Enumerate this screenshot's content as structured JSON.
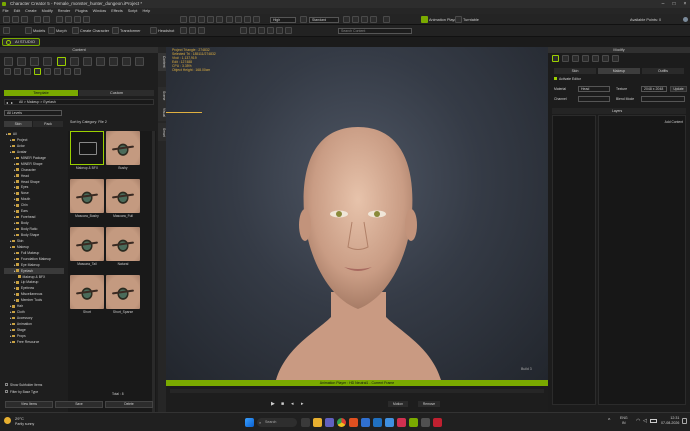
{
  "window": {
    "title": "Character Creator 5 - Female_monster_hunter_dungeon.iProject *"
  },
  "menu": [
    "File",
    "Edit",
    "Create",
    "Modify",
    "Render",
    "Plugins",
    "Window",
    "Effects",
    "Script",
    "Help"
  ],
  "toolbar": {
    "animation_player_label": "Animation Player",
    "turntable_label": "Turntable",
    "view_mode": "High",
    "camera": "Standard",
    "ai_studio_label": "AI STUDIO",
    "create_character_label": "Create Character",
    "transformer_label": "Transformer",
    "headshot_label": "Headshot",
    "search_placeholder": "Search Content",
    "models_label": "Models",
    "morph_label": "Morph",
    "avatar_status": "Available Points: 0"
  },
  "content_panel": {
    "title": "Content",
    "tabs": [
      "Template",
      "Custom"
    ],
    "path": "All > Makeup > Eyelash",
    "view_label": "All Levels",
    "side_tabs": [
      "Skin",
      "Pack"
    ],
    "sort_label": "Sort by Category: File 2",
    "tiles": [
      {
        "label": "Makeup & BFX"
      },
      {
        "label": "Bushy"
      },
      {
        "label": "Mascara_Bushy"
      },
      {
        "label": "Mascara_Full"
      },
      {
        "label": "Mascara_Tail"
      },
      {
        "label": "Natural"
      },
      {
        "label": "Short"
      },
      {
        "label": "Short_Sparse"
      }
    ],
    "tree": [
      {
        "label": "All",
        "level": 0
      },
      {
        "label": "Project",
        "level": 1
      },
      {
        "label": "Actor",
        "level": 1
      },
      {
        "label": "Avatar",
        "level": 1
      },
      {
        "label": "MINER Package",
        "level": 2
      },
      {
        "label": "MINER Shape",
        "level": 2
      },
      {
        "label": "Character",
        "level": 2
      },
      {
        "label": "Head",
        "level": 2
      },
      {
        "label": "Head Shape",
        "level": 2
      },
      {
        "label": "Eyes",
        "level": 2
      },
      {
        "label": "Nose",
        "level": 2
      },
      {
        "label": "Mouth",
        "level": 2
      },
      {
        "label": "Chin",
        "level": 2
      },
      {
        "label": "Ears",
        "level": 2
      },
      {
        "label": "Forehead",
        "level": 2
      },
      {
        "label": "Body",
        "level": 2
      },
      {
        "label": "Body Ratio",
        "level": 2
      },
      {
        "label": "Body Shape",
        "level": 2
      },
      {
        "label": "Skin",
        "level": 1
      },
      {
        "label": "Makeup",
        "level": 1
      },
      {
        "label": "Full Makeup",
        "level": 2
      },
      {
        "label": "Foundation Makeup",
        "level": 2
      },
      {
        "label": "Eye Makeup",
        "level": 2
      },
      {
        "label": "Eyelash",
        "level": 2,
        "selected": true
      },
      {
        "label": "Makeup & BFX",
        "level": 3
      },
      {
        "label": "Lip Makeup",
        "level": 2
      },
      {
        "label": "Eyebrow",
        "level": 2
      },
      {
        "label": "Miscellaneous",
        "level": 2
      },
      {
        "label": "Member Tools",
        "level": 2
      },
      {
        "label": "Hair",
        "level": 1
      },
      {
        "label": "Cloth",
        "level": 1
      },
      {
        "label": "Accessory",
        "level": 1
      },
      {
        "label": "Animation",
        "level": 1
      },
      {
        "label": "Stage",
        "level": 1
      },
      {
        "label": "Props",
        "level": 1
      },
      {
        "label": "Free Resource",
        "level": 1
      }
    ],
    "checkbox1": "Show Subfolder Items",
    "checkbox2": "Filter by Base Type",
    "total": "Total : 8",
    "buttons": [
      "View Items",
      "Save",
      "Delete"
    ]
  },
  "side_tabs_vertical": [
    "Content",
    "Scene",
    "Visual",
    "Smart"
  ],
  "viewport": {
    "stats": [
      "Project Triangle : 274832",
      "Selected Tri : 185111/274832",
      "Vtx# : 1,137,919",
      "Edit : 127488",
      "CPU : 3.35%",
      "Object Height : 168.00cm"
    ],
    "badge": "Build 3"
  },
  "anim_bar": {
    "label": "Animation Player : HD Neutral1 - Current Frame",
    "motion_label": "Motion",
    "remove_label": "Remove"
  },
  "modify_panel": {
    "title": "Modify",
    "tabs": [
      "Skin",
      "Makeup",
      "Outfits"
    ],
    "checkbox": "Activate Editor",
    "material_label": "Material",
    "material_value": "Head",
    "texture_label": "Texture",
    "texture_value": "2048 x 2048",
    "update_label": "Update",
    "channel_label": "Channel",
    "blend_label": "Blend Mode",
    "layers_label": "Layers",
    "add_label": "Add Content"
  },
  "taskbar": {
    "weather_temp": "29°C",
    "weather_desc": "Partly sunny",
    "search_placeholder": "Search",
    "lang": "ENG",
    "lang2": "IN",
    "time": "12:31",
    "date": "07-08-2026"
  },
  "colors": {
    "accent": "#9bd000"
  }
}
